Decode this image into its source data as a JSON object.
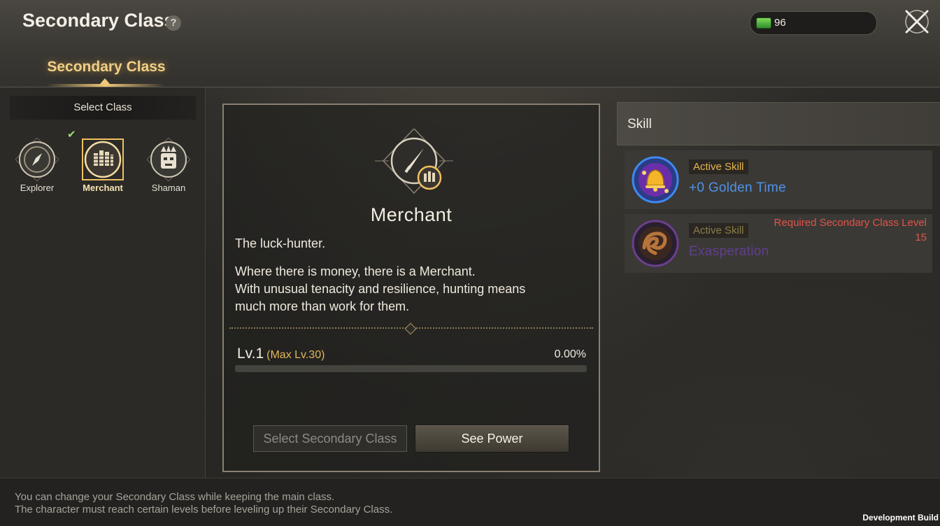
{
  "header": {
    "title": "Secondary Class",
    "help_glyph": "?",
    "currency_icon": "cash-bundle-icon",
    "currency_value": "96",
    "close_icon": "close-x-icon"
  },
  "tabs": [
    {
      "label": "Secondary Class",
      "active": true
    }
  ],
  "class_select": {
    "title": "Select Class",
    "classes": [
      {
        "name": "Explorer",
        "icon": "compass-icon",
        "selected": false
      },
      {
        "name": "Merchant",
        "icon": "coin-stacks-icon",
        "selected": true
      },
      {
        "name": "Shaman",
        "icon": "tribal-mask-icon",
        "selected": false
      }
    ],
    "selected_check_icon": "check-icon",
    "check_color": "#9fdc73"
  },
  "detail": {
    "emblem_icon": "dagger-icon",
    "class_name": "Merchant",
    "subtitle": "The luck-hunter.",
    "description": "Where there is money, there is a Merchant.\nWith unusual tenacity and resilience, hunting means\nmuch more than work for them.",
    "level": "Lv.1",
    "max_level": "(Max Lv.30)",
    "progress_text": "0.00%",
    "progress_fraction": 0,
    "buttons": {
      "select": "Select Secondary Class",
      "see_power": "See Power"
    }
  },
  "skills": {
    "title": "Skill",
    "items": [
      {
        "tag": "Active Skill",
        "name": "+0 Golden Time",
        "icon": "golden-bell-icon",
        "locked": false
      },
      {
        "tag": "Active Skill",
        "name": "Exasperation",
        "icon": "swirl-icon",
        "locked": true,
        "requirement": "Required Secondary Class Level",
        "requirement_level": "15"
      }
    ]
  },
  "footer": {
    "line1": "You can change your Secondary Class while keeping the main class.",
    "line2": "The character must reach certain levels before leveling up their Secondary Class.",
    "build": "Development Build"
  },
  "colors": {
    "accent_gold": "#f1cf85",
    "skill_blue": "#4f93e8",
    "skill_locked": "#5f3f8f",
    "warning_red": "#e0544a"
  }
}
